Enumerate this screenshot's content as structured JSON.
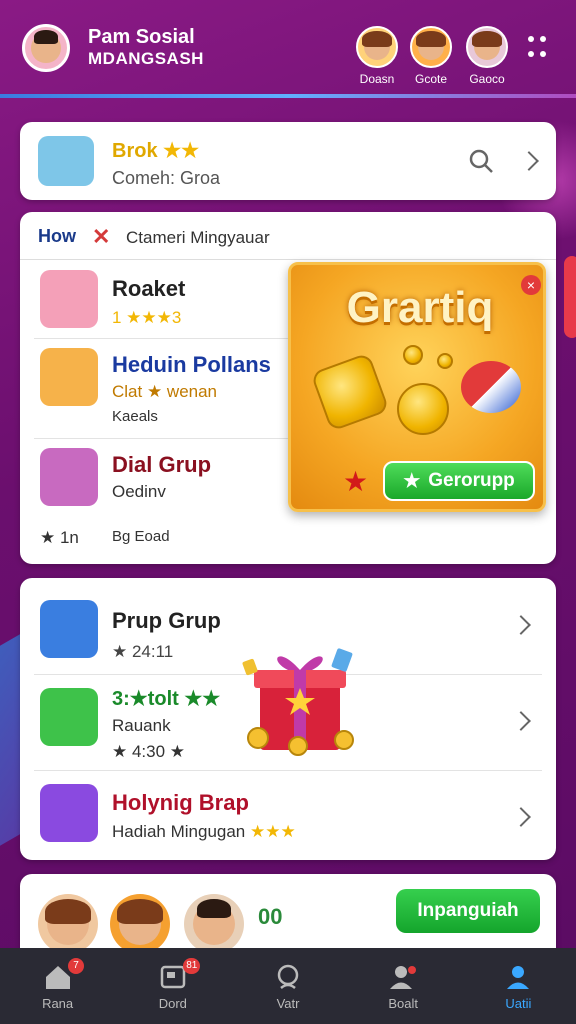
{
  "header": {
    "title_line1": "Pam Sosial",
    "title_line2": "MDANGSASH",
    "friends": [
      {
        "label": "Doasn"
      },
      {
        "label": "Gcote"
      },
      {
        "label": "Gaoco"
      }
    ]
  },
  "search_card": {
    "title": "Brok",
    "stars": "★★",
    "subtitle": "Comeh: Groa"
  },
  "list_card": {
    "tab_label": "How",
    "filter_text": "Ctameri Mingyauar",
    "rows": [
      {
        "title": "Roaket",
        "sub": "1 ★★★3"
      },
      {
        "title": "Heduin Pollans",
        "sub": "Clat ★ wenan",
        "sub2": "Kaeals"
      },
      {
        "title": "Dial Grup",
        "sub": "Oedinv"
      }
    ],
    "footer_count": "1n",
    "footer_text": "Bg Eoad"
  },
  "popup": {
    "title": "Grartiq",
    "button_label": "Gerorupp",
    "close_label": "×"
  },
  "group_card": {
    "rows": [
      {
        "title": "Prup Grup",
        "sub": "★ 24:11"
      },
      {
        "title": "3:★tolt ★★",
        "sub": "Rauank",
        "sub2": "★ 4:30 ★"
      },
      {
        "title": "Holynig Brap",
        "sub": "Hadiah Mingugan",
        "stars": "★★★"
      }
    ]
  },
  "bottom_card": {
    "count": "00",
    "join_label": "Inpanguiah"
  },
  "nav": {
    "items": [
      {
        "label": "Rana",
        "badge": "7"
      },
      {
        "label": "Dord",
        "badge": "81"
      },
      {
        "label": "Vatr",
        "badge": ""
      },
      {
        "label": "Boalt",
        "badge": ""
      },
      {
        "label": "Uatii",
        "badge": ""
      }
    ]
  },
  "colors": {
    "background": "#6b0f6e",
    "accent_gold": "#f5a623",
    "accent_green": "#1aa82a",
    "nav_active": "#3aa8ff"
  }
}
